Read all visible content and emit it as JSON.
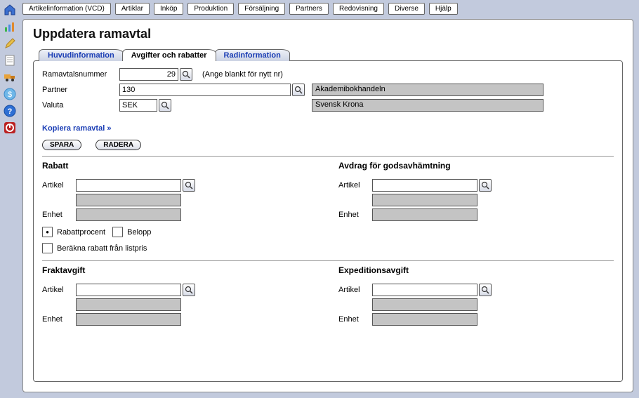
{
  "menu": {
    "items": [
      "Artikelinformation (VCD)",
      "Artiklar",
      "Inköp",
      "Produktion",
      "Försäljning",
      "Partners",
      "Redovisning",
      "Diverse",
      "Hjälp"
    ]
  },
  "page": {
    "title": "Uppdatera ramavtal"
  },
  "tabs": {
    "items": [
      "Huvudinformation",
      "Avgifter och rabatter",
      "Radinformation"
    ],
    "active_index": 1
  },
  "form": {
    "ramavtalsnummer": {
      "label": "Ramavtalsnummer",
      "value": "29",
      "hint": "(Ange blankt för nytt nr)"
    },
    "partner": {
      "label": "Partner",
      "value": "130",
      "display": "Akademibokhandeln"
    },
    "valuta": {
      "label": "Valuta",
      "value": "SEK",
      "display": "Svensk Krona"
    },
    "copy_link": "Kopiera ramavtal »",
    "save_btn": "SPARA",
    "delete_btn": "RADERA"
  },
  "sections": {
    "rabatt": {
      "title": "Rabatt",
      "artikel_label": "Artikel",
      "artikel_value": "",
      "artikel_display": "",
      "enhet_label": "Enhet",
      "enhet_display": "",
      "rabattprocent_label": "Rabattprocent",
      "belopp_label": "Belopp",
      "berakna_label": "Beräkna rabatt från listpris"
    },
    "avdrag": {
      "title": "Avdrag för godsavhämtning",
      "artikel_label": "Artikel",
      "artikel_value": "",
      "artikel_display": "",
      "enhet_label": "Enhet",
      "enhet_display": ""
    },
    "frakt": {
      "title": "Fraktavgift",
      "artikel_label": "Artikel",
      "artikel_value": "",
      "artikel_display": "",
      "enhet_label": "Enhet",
      "enhet_display": ""
    },
    "expedition": {
      "title": "Expeditionsavgift",
      "artikel_label": "Artikel",
      "artikel_value": "",
      "artikel_display": "",
      "enhet_label": "Enhet",
      "enhet_display": ""
    }
  }
}
